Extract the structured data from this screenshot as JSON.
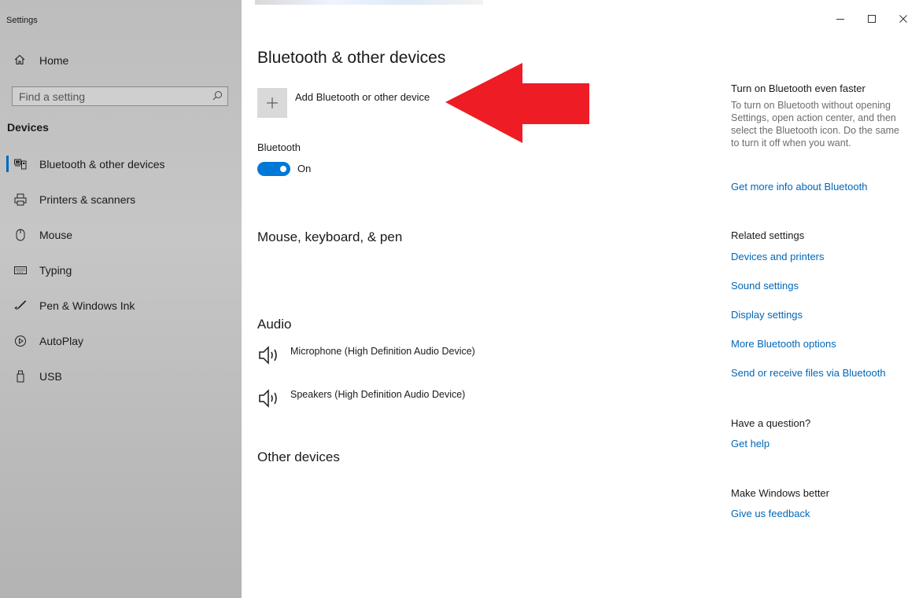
{
  "window": {
    "title": "Settings",
    "controls": {
      "minimize": "–",
      "maximize": "☐",
      "close": "✕"
    }
  },
  "sidebar": {
    "home_label": "Home",
    "search_placeholder": "Find a setting",
    "section_label": "Devices",
    "items": [
      {
        "label": "Bluetooth & other devices",
        "icon": "bluetooth-devices-icon",
        "active": true
      },
      {
        "label": "Printers & scanners",
        "icon": "printer-icon"
      },
      {
        "label": "Mouse",
        "icon": "mouse-icon"
      },
      {
        "label": "Typing",
        "icon": "keyboard-icon"
      },
      {
        "label": "Pen & Windows Ink",
        "icon": "pen-icon"
      },
      {
        "label": "AutoPlay",
        "icon": "autoplay-icon"
      },
      {
        "label": "USB",
        "icon": "usb-icon"
      }
    ]
  },
  "main": {
    "title": "Bluetooth & other devices",
    "add_device_label": "Add Bluetooth or other device",
    "bluetooth_label": "Bluetooth",
    "bluetooth_state": "On",
    "sections": {
      "mouse": "Mouse, keyboard, & pen",
      "audio": "Audio",
      "other": "Other devices"
    },
    "audio_devices": [
      {
        "name": "Microphone (High Definition Audio Device)",
        "icon": "speaker-icon"
      },
      {
        "name": "Speakers (High Definition Audio Device)",
        "icon": "speaker-icon"
      }
    ]
  },
  "right_pane": {
    "faster_heading": "Turn on Bluetooth even faster",
    "faster_text": "To turn on Bluetooth without opening Settings, open action center, and then select the Bluetooth icon. Do the same to turn it off when you want.",
    "more_info_link": "Get more info about Bluetooth",
    "related_heading": "Related settings",
    "related_links": [
      "Devices and printers",
      "Sound settings",
      "Display settings",
      "More Bluetooth options",
      "Send or receive files via Bluetooth"
    ],
    "question_heading": "Have a question?",
    "help_link": "Get help",
    "better_heading": "Make Windows better",
    "feedback_link": "Give us feedback"
  },
  "colors": {
    "accent": "#0078d7",
    "link": "#0067b8",
    "annotation_arrow": "#ee1c25",
    "sidebar_bg": "#c2c2c2"
  }
}
